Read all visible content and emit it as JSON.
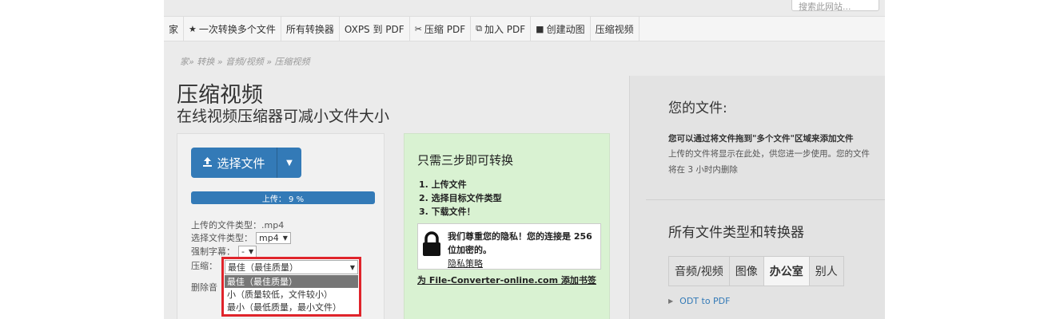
{
  "header": {
    "logo_fragment": "...",
    "search_placeholder": "搜索此网站..."
  },
  "nav": [
    {
      "icon": "",
      "label": "家"
    },
    {
      "icon": "★",
      "label": "一次转换多个文件"
    },
    {
      "icon": "",
      "label": "所有转换器"
    },
    {
      "icon": "",
      "label": "OXPS 到 PDF"
    },
    {
      "icon": "✂",
      "label": "压缩 PDF"
    },
    {
      "icon": "⧉",
      "label": "加入 PDF"
    },
    {
      "icon": "■",
      "label": "创建动图"
    },
    {
      "icon": "",
      "label": "压缩视频"
    }
  ],
  "breadcrumb": "家» 转换 » 音频/视频 » 压缩视频",
  "main": {
    "title": "压缩视频",
    "subtitle": "在线视频压缩器可减小文件大小",
    "choose_label": "选择文件",
    "progress_label": "上传： 9 %",
    "progress_value": 0.09,
    "uploaded_type_label": "上传的文件类型：",
    "uploaded_type_value": ".mp4",
    "target_type_label": "选择文件类型：",
    "target_type_value": "mp4",
    "subtitle_label": "强制字幕：",
    "subtitle_value": "-",
    "compress_label": "压缩：",
    "remove_audio_label": "删除音",
    "compress_options": [
      "最佳（最佳质量）",
      "小（质量较低，文件较小）",
      "最小（最低质量，最小文件）"
    ],
    "compress_selected": "最佳（最佳质量）"
  },
  "steps": {
    "title": "只需三步即可转换",
    "items": [
      "1. 上传文件",
      "2. 选择目标文件类型",
      "3. 下载文件！"
    ],
    "privacy_text": "我们尊重您的隐私！您的连接是 256 位加密的。",
    "privacy_link": "隐私策略",
    "bookmark": "为 File-Converter-online.com 添加书签"
  },
  "right": {
    "title": "您的文件:",
    "bold_line": "您可以通过将文件拖到\"多个文件\"区域来添加文件",
    "description": "上传的文件将显示在此处，供您进一步使用。您的文件将在 3 小时内删除",
    "title2": "所有文件类型和转换器",
    "tabs": [
      "音频/视频",
      "图像",
      "办公室",
      "别人"
    ],
    "active_tab": "办公室",
    "list_item": "ODT to PDF"
  }
}
